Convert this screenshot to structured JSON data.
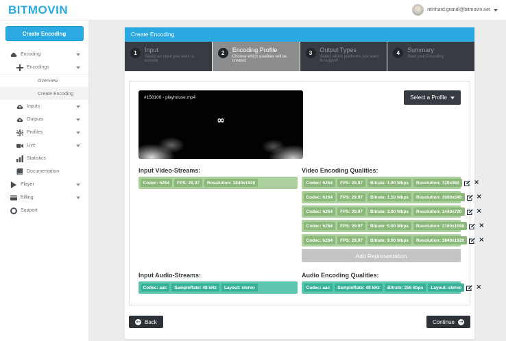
{
  "header": {
    "logo": "BITMOVIN",
    "user_email": "reinhard.grandl@bitmovin.net"
  },
  "sidebar": {
    "create_button": "Create Encoding",
    "items": [
      {
        "label": "Encoding",
        "icon": "cloud",
        "caret": true,
        "level": 1,
        "active": false
      },
      {
        "label": "Encodings",
        "icon": "plus",
        "caret": true,
        "level": 2,
        "active": false
      },
      {
        "label": "Overview",
        "icon": null,
        "caret": false,
        "level": 3,
        "active": false
      },
      {
        "label": "Create Encoding",
        "icon": null,
        "caret": false,
        "level": 3,
        "active": true
      },
      {
        "label": "Inputs",
        "icon": "cloud-upload",
        "caret": true,
        "level": 2,
        "active": false
      },
      {
        "label": "Outputs",
        "icon": "cloud-download",
        "caret": true,
        "level": 2,
        "active": false
      },
      {
        "label": "Profiles",
        "icon": "gears",
        "caret": true,
        "level": 2,
        "active": false
      },
      {
        "label": "Live",
        "icon": "video-camera",
        "caret": true,
        "level": 2,
        "active": false
      },
      {
        "label": "Statistics",
        "icon": "bar-chart",
        "caret": false,
        "level": 2,
        "active": false
      },
      {
        "label": "Documentation",
        "icon": "book",
        "caret": false,
        "level": 2,
        "active": false
      },
      {
        "label": "Player",
        "icon": "play",
        "caret": true,
        "level": 1,
        "active": false
      },
      {
        "label": "Billing",
        "icon": "credit-card",
        "caret": true,
        "level": 1,
        "active": false
      },
      {
        "label": "Support",
        "icon": "life-ring",
        "caret": false,
        "level": 1,
        "active": false
      }
    ]
  },
  "main": {
    "panel_title": "Create Encoding",
    "steps": [
      {
        "num": "1",
        "title": "Input",
        "subtitle": "Select an input you want to encode",
        "active": false
      },
      {
        "num": "2",
        "title": "Encoding Profile",
        "subtitle": "Choose which qualities will be created",
        "active": true
      },
      {
        "num": "3",
        "title": "Output Types",
        "subtitle": "Select which platforms you want to support",
        "active": false
      },
      {
        "num": "4",
        "title": "Summary",
        "subtitle": "Start your Encoding",
        "active": false
      }
    ],
    "video_preview": {
      "label": "#158106 - playhouse.mp4",
      "goggles_glyph": "∞"
    },
    "select_profile_label": "Select a Profile",
    "input_video": {
      "heading": "Input Video-Streams:",
      "badges": [
        "Codec: h264",
        "FPS: 29.97",
        "Resolution: 3840x1920"
      ]
    },
    "video_qualities": {
      "heading": "Video Encoding Qualities:",
      "rows": [
        [
          "Codec: h264",
          "FPS: 29.97",
          "Bitrate: 1.00 Mbps",
          "Resolution: 720x360"
        ],
        [
          "Codec: h264",
          "FPS: 29.97",
          "Bitrate: 1.50 Mbps",
          "Resolution: 1080x540"
        ],
        [
          "Codec: h264",
          "FPS: 29.97",
          "Bitrate: 3.00 Mbps",
          "Resolution: 1440x720"
        ],
        [
          "Codec: h264",
          "FPS: 29.97",
          "Bitrate: 5.00 Mbps",
          "Resolution: 2160x1080"
        ],
        [
          "Codec: h264",
          "FPS: 29.97",
          "Bitrate: 9.00 Mbps",
          "Resolution: 3840x1920"
        ]
      ],
      "add_label": "Add Representation"
    },
    "input_audio": {
      "heading": "Input Audio-Streams:",
      "badges": [
        "Codec: aac",
        "SampleRate: 48 kHz",
        "Layout: stereo"
      ]
    },
    "audio_qualities": {
      "heading": "Audio Encoding Qualities:",
      "rows": [
        [
          "Codec: aac",
          "SampleRate: 48 kHz",
          "Bitrate: 256 kbps",
          "Layout: stereo"
        ]
      ]
    },
    "back_label": "Back",
    "continue_label": "Continue"
  },
  "colors": {
    "accent_blue": "#2baae1",
    "step_dark": "#373c42",
    "step_active": "#8a8c8e",
    "video_bar": "#accf9e",
    "video_badge": "#8bb97a",
    "audio_bar": "#5ec5b1",
    "audio_badge": "#3bb199",
    "add_button_gray": "#c4c4c4",
    "dark_button": "#2c3237"
  }
}
